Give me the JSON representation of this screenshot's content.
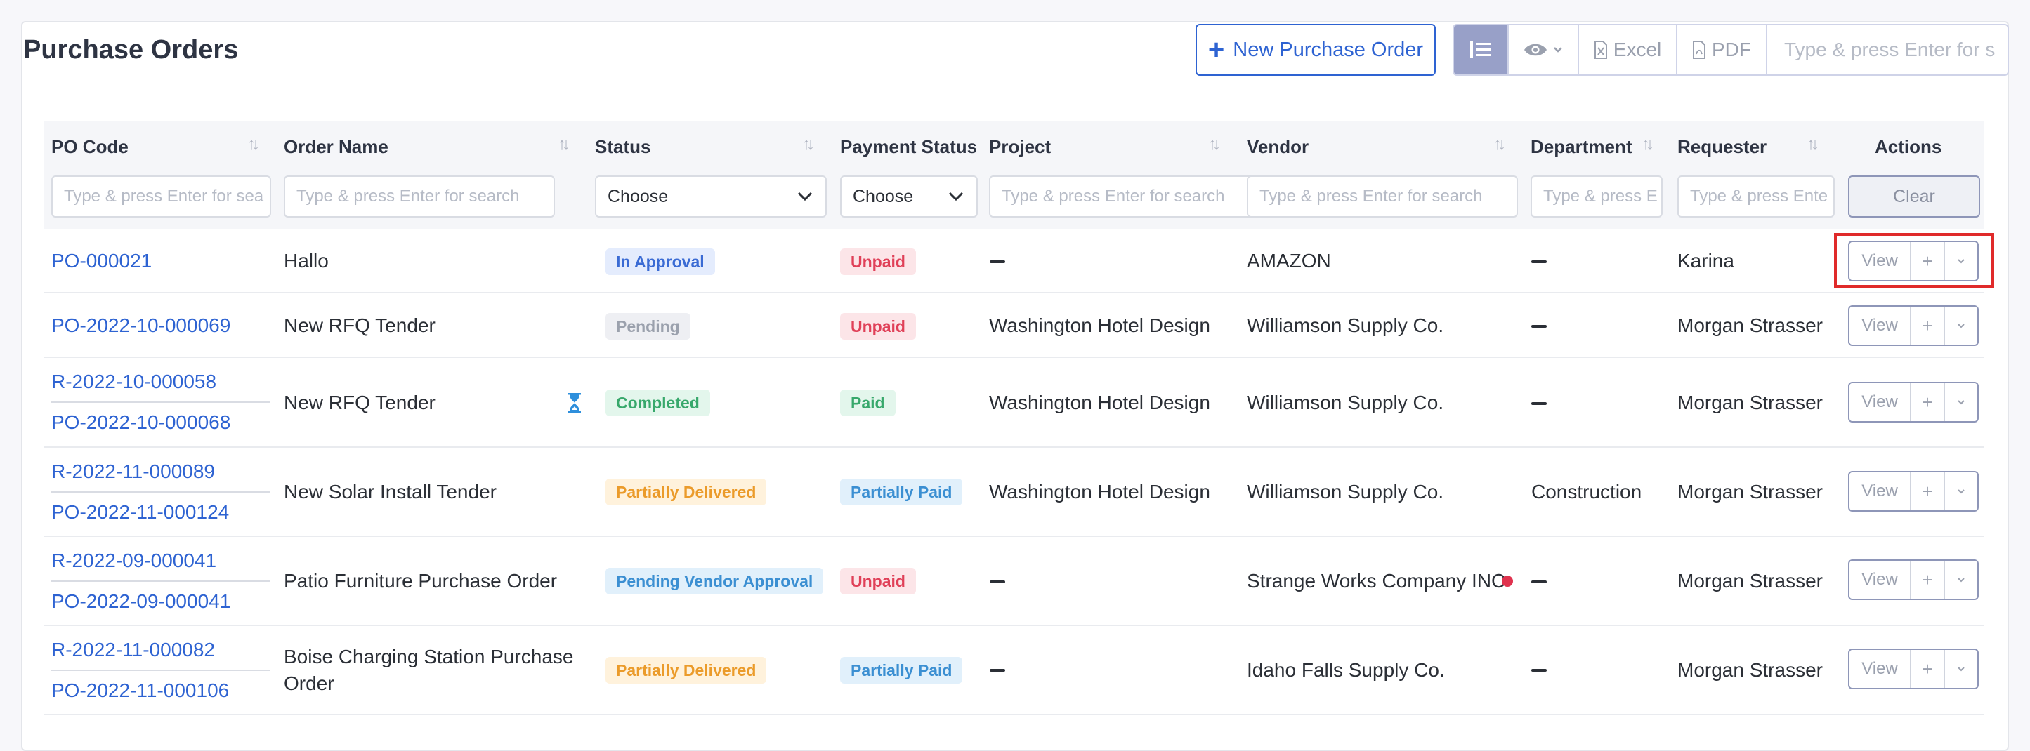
{
  "page": {
    "title": "Purchase Orders"
  },
  "toolbar": {
    "new_label": "New Purchase Order",
    "excel_label": "Excel",
    "pdf_label": "PDF",
    "search_placeholder": "Type & press Enter for s"
  },
  "columns": {
    "po_code": "PO Code",
    "order_name": "Order Name",
    "status": "Status",
    "payment_status": "Payment Status",
    "project": "Project",
    "vendor": "Vendor",
    "department": "Department",
    "requester": "Requester",
    "actions": "Actions"
  },
  "filters": {
    "po_code": "Type & press Enter for sea",
    "order_name": "Type & press Enter for search",
    "status": "Choose",
    "payment_status": "Choose",
    "project": "Type & press Enter for search",
    "vendor": "Type & press Enter for search",
    "department": "Type & press E",
    "requester": "Type & press Ente",
    "clear_label": "Clear"
  },
  "actions": {
    "view_label": "View",
    "plus_label": "+"
  },
  "rows": [
    {
      "codes": [
        "PO-000021"
      ],
      "order_name": "Hallo",
      "status": "In Approval",
      "payment": "Unpaid",
      "project": "",
      "vendor": "AMAZON",
      "department": "",
      "requester": "Karina"
    },
    {
      "codes": [
        "PO-2022-10-000069"
      ],
      "order_name": "New RFQ Tender",
      "status": "Pending",
      "payment": "Unpaid",
      "project": "Washington Hotel Design",
      "vendor": "Williamson Supply Co.",
      "department": "",
      "requester": "Morgan Strasser"
    },
    {
      "codes": [
        "R-2022-10-000058",
        "PO-2022-10-000068"
      ],
      "order_name": "New RFQ Tender",
      "status": "Completed",
      "payment": "Paid",
      "project": "Washington Hotel Design",
      "vendor": "Williamson Supply Co.",
      "department": "",
      "requester": "Morgan Strasser"
    },
    {
      "codes": [
        "R-2022-11-000089",
        "PO-2022-11-000124"
      ],
      "order_name": "New Solar Install Tender",
      "status": "Partially Delivered",
      "payment": "Partially Paid",
      "project": "Washington Hotel Design",
      "vendor": "Williamson Supply Co.",
      "department": "Construction",
      "requester": "Morgan Strasser"
    },
    {
      "codes": [
        "R-2022-09-000041",
        "PO-2022-09-000041"
      ],
      "order_name": "Patio Furniture Purchase Order",
      "status": "Pending Vendor Approval",
      "payment": "Unpaid",
      "project": "",
      "vendor": "Strange Works Company INC",
      "department": "",
      "requester": "Morgan Strasser"
    },
    {
      "codes": [
        "R-2022-11-000082",
        "PO-2022-11-000106"
      ],
      "order_name_lines": [
        "Boise Charging Station Purchase",
        "Order"
      ],
      "status": "Partially Delivered",
      "payment": "Partially Paid",
      "project": "",
      "vendor": "Idaho Falls Supply Co.",
      "department": "",
      "requester": "Morgan Strasser"
    }
  ],
  "colors": {
    "accent": "#2e63d2",
    "highlight": "#e02a2a",
    "list_toggle": "#98a0c8"
  }
}
